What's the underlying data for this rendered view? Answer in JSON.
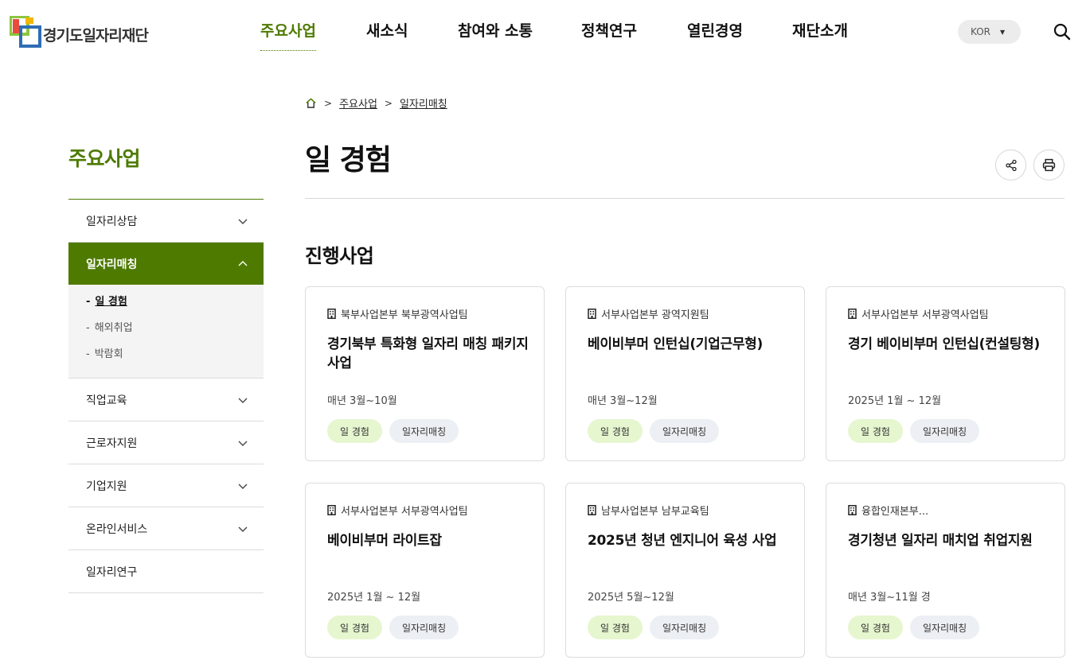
{
  "header": {
    "logo_text": "경기도일자리재단",
    "nav": [
      {
        "label": "주요사업",
        "active": true
      },
      {
        "label": "새소식",
        "active": false
      },
      {
        "label": "참여와 소통",
        "active": false
      },
      {
        "label": "정책연구",
        "active": false
      },
      {
        "label": "열린경영",
        "active": false
      },
      {
        "label": "재단소개",
        "active": false
      }
    ],
    "language": "KOR",
    "icons": {
      "search": "search-icon",
      "lang_caret": "caret-down-icon"
    }
  },
  "sidebar": {
    "title": "주요사업",
    "items": [
      {
        "label": "일자리상담"
      },
      {
        "label": "일자리매칭"
      },
      {
        "label": "직업교육"
      },
      {
        "label": "근로자지원"
      },
      {
        "label": "기업지원"
      },
      {
        "label": "온라인서비스"
      },
      {
        "label": "일자리연구"
      }
    ],
    "open_index": 1,
    "sub_items": [
      {
        "label": "일 경험",
        "current": true
      },
      {
        "label": "해외취업",
        "current": false
      },
      {
        "label": "박람회",
        "current": false
      }
    ]
  },
  "breadcrumb": {
    "home_icon": "home-icon",
    "items": [
      "주요사업",
      "일자리매칭"
    ]
  },
  "page": {
    "title": "일 경험",
    "share_icon": "share-icon",
    "print_icon": "print-icon",
    "section_title": "진행사업"
  },
  "cards": [
    {
      "dept": "북부사업본부 북부광역사업팀",
      "title": "경기북부 특화형 일자리 매칭 패키지 사업",
      "period": "매년 3월~10월",
      "tags": [
        "일 경험",
        "일자리매칭"
      ]
    },
    {
      "dept": "서부사업본부 광역지원팀",
      "title": "베이비부머 인턴십(기업근무형)",
      "period": "매년 3월~12월",
      "tags": [
        "일 경험",
        "일자리매칭"
      ]
    },
    {
      "dept": "서부사업본부 서부광역사업팀",
      "title": "경기 베이비부머 인턴십(컨설팅형)",
      "period": "2025년 1월 ~ 12월",
      "tags": [
        "일 경험",
        "일자리매칭"
      ]
    },
    {
      "dept": "서부사업본부 서부광역사업팀",
      "title": "베이비부머 라이트잡",
      "period": "2025년 1월 ~ 12월",
      "tags": [
        "일 경험",
        "일자리매칭"
      ]
    },
    {
      "dept": "남부사업본부 남부교육팀",
      "title": "2025년 청년 엔지니어 육성 사업",
      "period": "2025년 5월~12월",
      "tags": [
        "일 경험",
        "일자리매칭"
      ]
    },
    {
      "dept": "융합인재본부...",
      "title": "경기청년 일자리 매치업 취업지원",
      "period": "매년 3월~11월 경",
      "tags": [
        "일 경험",
        "일자리매칭"
      ]
    }
  ],
  "colors": {
    "brand_green": "#4e7a00",
    "tag_green_bg": "#e6f6cf",
    "tag_gray_bg": "#eceff3"
  }
}
